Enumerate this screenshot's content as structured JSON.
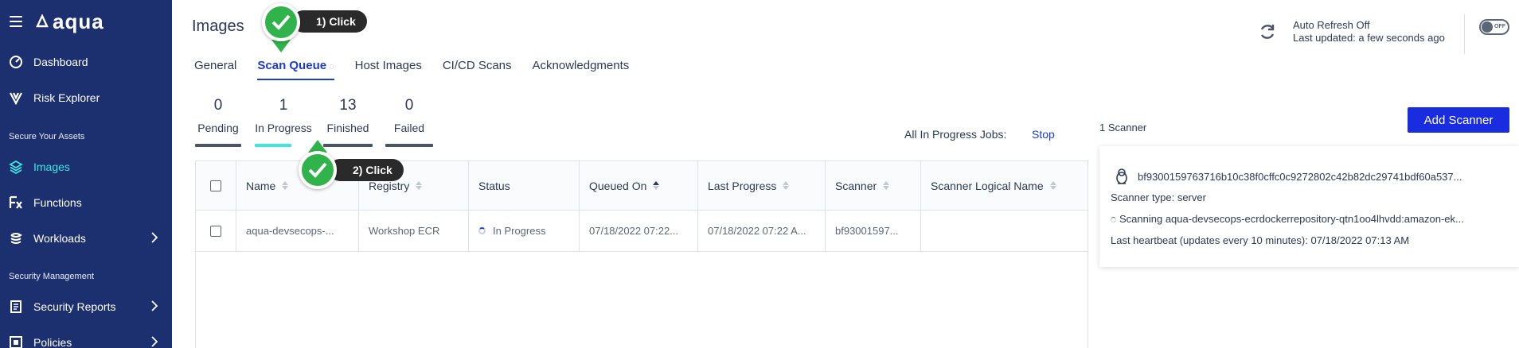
{
  "app": {
    "logo_text": "aqua"
  },
  "sidebar": {
    "items": [
      {
        "label": "Dashboard",
        "icon": "gauge-icon"
      },
      {
        "label": "Risk Explorer",
        "icon": "risk-explorer-icon"
      },
      {
        "label": "Images",
        "icon": "layers-icon"
      },
      {
        "label": "Functions",
        "icon": "function-icon"
      },
      {
        "label": "Workloads",
        "icon": "workloads-icon"
      },
      {
        "label": "Security Reports",
        "icon": "report-icon"
      },
      {
        "label": "Policies",
        "icon": "policies-icon"
      }
    ],
    "sections": [
      "Secure Your Assets",
      "Security Management"
    ],
    "active_item": "Images",
    "active_color": "#3ee6e0"
  },
  "header": {
    "title": "Images",
    "tabs": [
      "General",
      "Scan Queue",
      "Host Images",
      "CI/CD Scans",
      "Acknowledgments"
    ],
    "active_tab": "Scan Queue",
    "auto_refresh_label": "Auto Refresh Off",
    "last_updated": "Last updated: a few seconds ago",
    "toggle_label": "OFF"
  },
  "counters": [
    {
      "count": "0",
      "label": "Pending"
    },
    {
      "count": "1",
      "label": "In Progress"
    },
    {
      "count": "13",
      "label": "Finished"
    },
    {
      "count": "0",
      "label": "Failed"
    }
  ],
  "jobs": {
    "label": "All In Progress Jobs:",
    "stop": "Stop"
  },
  "table": {
    "columns": [
      "Name",
      "Registry",
      "Status",
      "Queued On",
      "Last Progress",
      "Scanner",
      "Scanner Logical Name"
    ],
    "rows": [
      {
        "name": "aqua-devsecops-...",
        "registry": "Workshop ECR",
        "status": "In Progress",
        "queued_on": "07/18/2022 07:22...",
        "last_progress": "07/18/2022 07:22 A...",
        "scanner": "bf93001597...",
        "scanner_logical_name": ""
      }
    ]
  },
  "scanners": {
    "count_label": "1 Scanner",
    "add_button": "Add Scanner",
    "card": {
      "name": "bf9300159763716b10c38f0cffc0c9272802c42b82dc29741bdf60a537...",
      "type": "Scanner type: server",
      "scanning": "Scanning aqua-devsecops-ecrdockerrepository-qtn1oo4lhvdd:amazon-ek...",
      "heartbeat": "Last heartbeat (updates every 10 minutes): 07/18/2022 07:13 AM"
    }
  },
  "annotations": {
    "step1": "1) Click",
    "step2": "2) Click",
    "color": "#2fb34a"
  }
}
